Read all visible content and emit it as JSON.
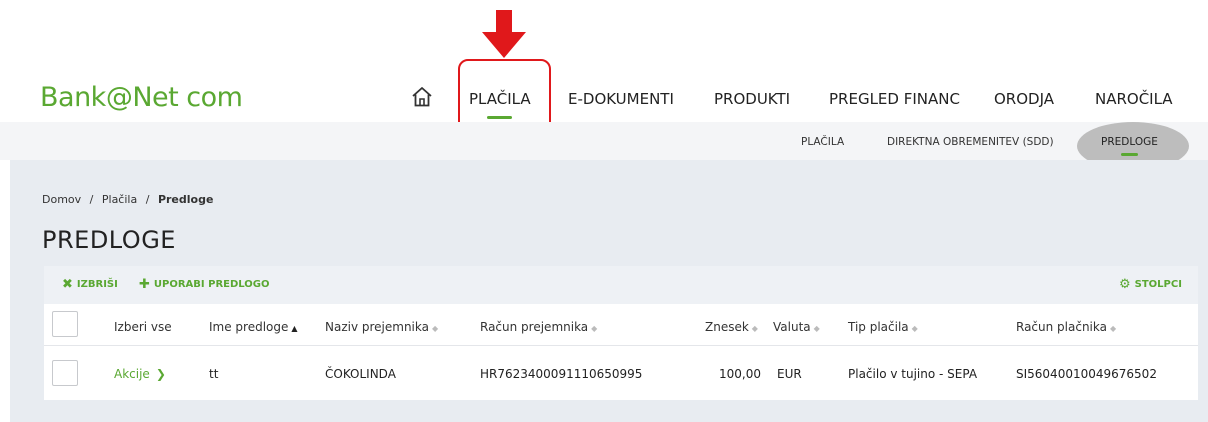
{
  "app": {
    "logo": "Bank@Net com"
  },
  "nav": {
    "items": [
      {
        "label": "PLAČILA",
        "active": true
      },
      {
        "label": "E-DOKUMENTI"
      },
      {
        "label": "PRODUKTI"
      },
      {
        "label": "PREGLED FINANC"
      },
      {
        "label": "ORODJA"
      },
      {
        "label": "NAROČILA"
      }
    ]
  },
  "subnav": {
    "items": [
      {
        "label": "PLAČILA"
      },
      {
        "label": "DIREKTNA OBREMENITEV (SDD)"
      },
      {
        "label": "PREDLOGE",
        "active": true
      }
    ]
  },
  "breadcrumb": {
    "home": "Domov",
    "sep": "/",
    "section": "Plačila",
    "current": "Predloge"
  },
  "page": {
    "title": "PREDLOGE"
  },
  "toolbar": {
    "delete_label": "IZBRIŠI",
    "use_template_label": "UPORABI PREDLOGO",
    "columns_label": "STOLPCI"
  },
  "table": {
    "headers": {
      "select_all": "Izberi vse",
      "template_name": "Ime predloge",
      "recipient_name": "Naziv prejemnika",
      "recipient_account": "Račun prejemnika",
      "amount": "Znesek",
      "currency": "Valuta",
      "payment_type": "Tip plačila",
      "payer_account": "Račun plačnika"
    },
    "rows": [
      {
        "actions": "Akcije",
        "template_name": "tt",
        "recipient_name": "ČOKOLINDA",
        "recipient_account": "HR7623400091110650995",
        "amount": "100,00",
        "currency": "EUR",
        "payment_type": "Plačilo v tujino - SEPA",
        "payer_account": "SI56040010049676502"
      }
    ]
  },
  "colors": {
    "accent": "#5aa832",
    "annotation": "#e0181b",
    "content_bg": "#e8ecf1"
  }
}
